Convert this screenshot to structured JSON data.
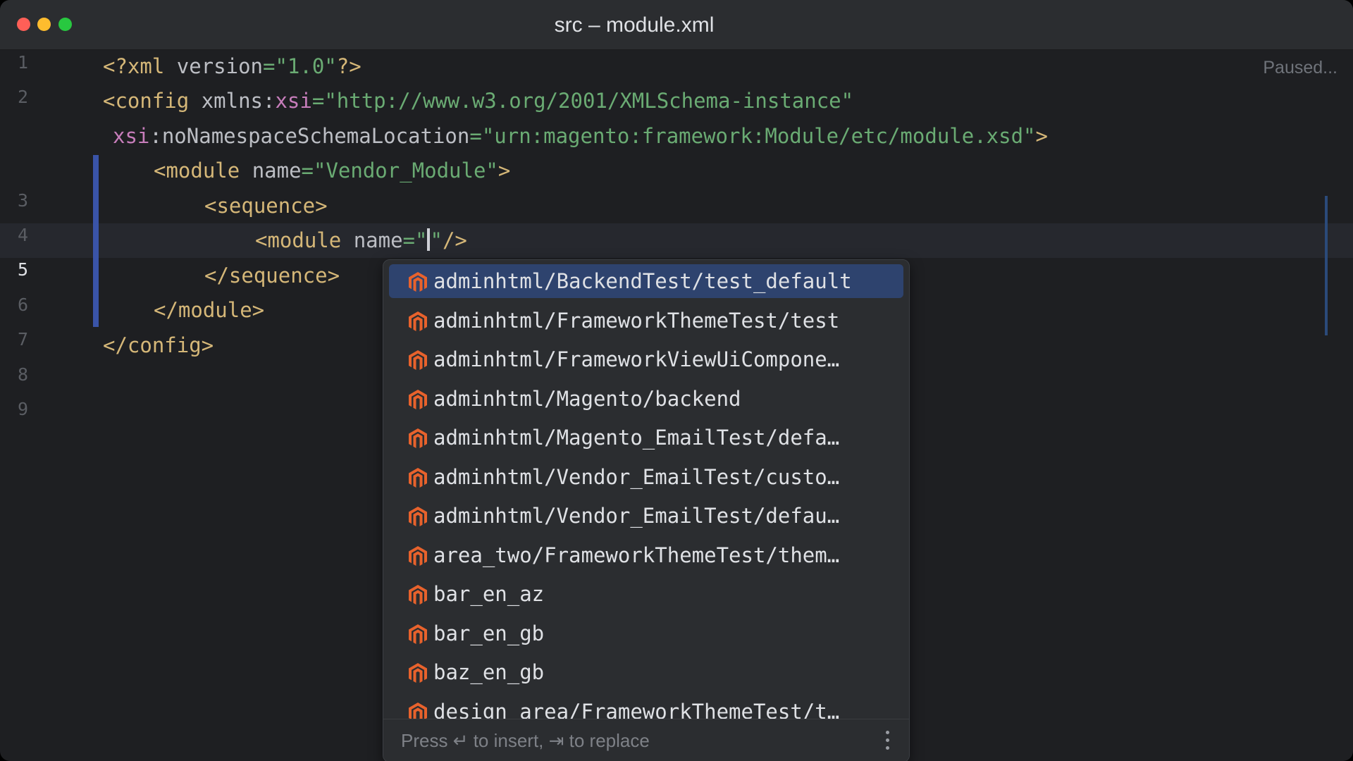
{
  "window": {
    "title": "src – module.xml"
  },
  "status": {
    "paused": "Paused..."
  },
  "gutter": [
    "1",
    "2",
    "3",
    "4",
    "5",
    "6",
    "7",
    "8",
    "9"
  ],
  "code": {
    "l1": {
      "open": "<?xml ",
      "attr": "version",
      "eq": "=",
      "val": "\"1.0\"",
      "close": "?>"
    },
    "l2": {
      "tag": "<config ",
      "attr": "xmlns:",
      "ns": "xsi",
      "eq": "=",
      "val": "\"http://www.w3.org/2001/XMLSchema-instance\""
    },
    "l2b": {
      "ns": "xsi",
      "attr": ":noNamespaceSchemaLocation",
      "eq": "=",
      "val": "\"urn:magento:framework:Module/etc/module.xsd\"",
      "close": ">"
    },
    "l3": {
      "tag": "<module ",
      "attr": "name",
      "eq": "=",
      "val": "\"Vendor_Module\"",
      "close": ">"
    },
    "l4": {
      "tag": "<sequence>"
    },
    "l5": {
      "tag": "<module ",
      "attr": "name",
      "eq": "=",
      "val_open": "\"",
      "val_close": "\"",
      "close": "/>"
    },
    "l6": {
      "tag": "</sequence>"
    },
    "l7": {
      "tag": "</module>"
    },
    "l8": {
      "tag": "</config>"
    }
  },
  "completion": {
    "items": [
      {
        "label": "adminhtml/BackendTest/test_default",
        "selected": true
      },
      {
        "label": "adminhtml/FrameworkThemeTest/test"
      },
      {
        "label": "adminhtml/FrameworkViewUiCompone…"
      },
      {
        "label": "adminhtml/Magento/backend"
      },
      {
        "label": "adminhtml/Magento_EmailTest/defa…"
      },
      {
        "label": "adminhtml/Vendor_EmailTest/custo…"
      },
      {
        "label": "adminhtml/Vendor_EmailTest/defau…"
      },
      {
        "label": "area_two/FrameworkThemeTest/them…"
      },
      {
        "label": "bar_en_az"
      },
      {
        "label": "bar_en_gb"
      },
      {
        "label": "baz_en_gb"
      },
      {
        "label": "design_area/FrameworkThemeTest/t…"
      }
    ],
    "icon": "magento-icon",
    "icon_color": "#e8622c",
    "footer_hint": "Press ↵ to insert, ⇥ to replace"
  },
  "colors": {
    "background": "#1e1f22",
    "tag": "#d5b778",
    "string": "#6aab73",
    "namespace": "#c77dbb",
    "selection": "#2e436e"
  }
}
